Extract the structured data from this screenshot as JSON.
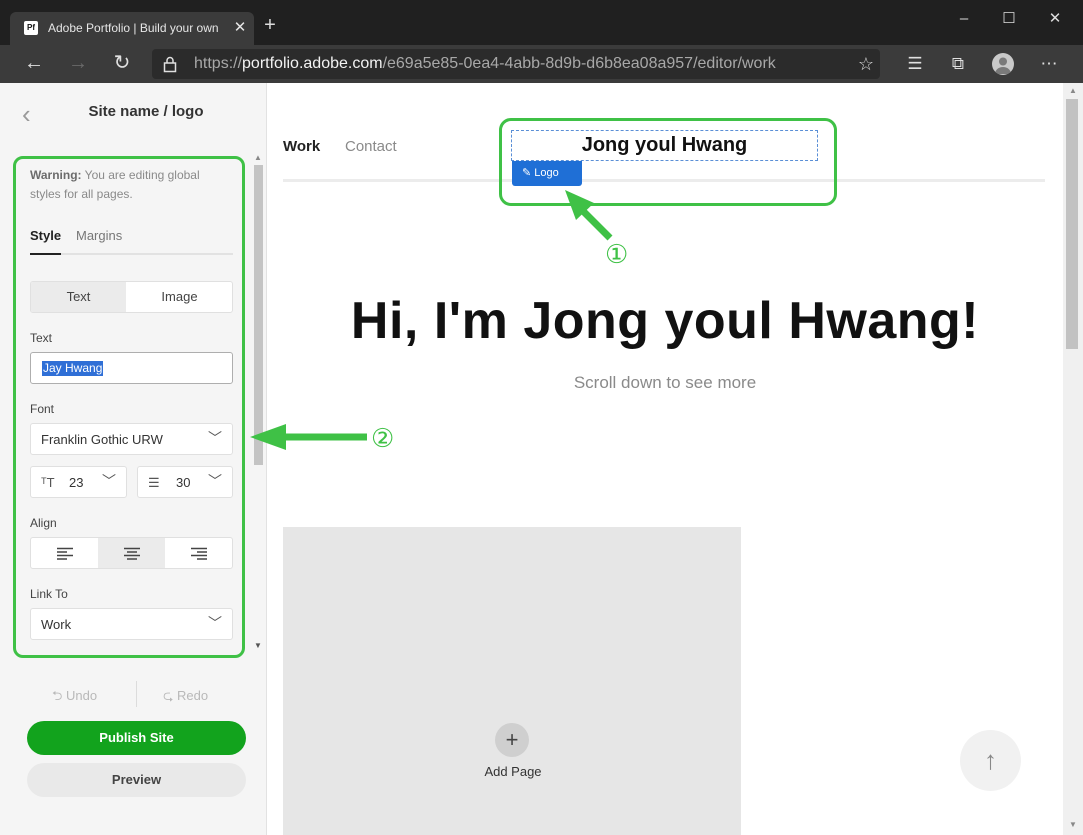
{
  "browser": {
    "tab_title": "Adobe Portfolio | Build your own",
    "tab_favicon": "Pf",
    "tab_close": "✕",
    "new_tab": "+",
    "url_prefix": "https://",
    "url_host": "portfolio.adobe.com",
    "url_path": "/e69a5e85-0ea4-4abb-8d9b-d6b8ea08a957/editor/work",
    "window_controls": {
      "minimize": "–",
      "maximize": "☐",
      "close": "✕"
    },
    "nav_icons": [
      "back-arrow-icon",
      "forward-arrow-icon",
      "refresh-icon"
    ],
    "toolbar_icons": [
      "favorites-star-icon",
      "reading-list-icon",
      "collections-icon",
      "profile-icon",
      "more-icon"
    ]
  },
  "panel": {
    "back": "‹",
    "title": "Site name / logo",
    "warning_bold": "Warning:",
    "warning_text": " You are editing global styles for all pages.",
    "tabs": {
      "style": "Style",
      "margins": "Margins"
    },
    "segment": {
      "text": "Text",
      "image": "Image"
    },
    "text_label": "Text",
    "text_value": "Jay Hwang",
    "font_label": "Font",
    "font_value": "Franklin Gothic URW",
    "size_icon": "ᵀT",
    "size_value": "23",
    "line_height_icon": "☰",
    "line_height_value": "30",
    "chevron": "﹀",
    "align_label": "Align",
    "align_selected": "center",
    "link_label": "Link To",
    "link_value": "Work",
    "undo": "⮌  Undo",
    "redo": "⮎  Redo",
    "publish": "Publish Site",
    "preview": "Preview"
  },
  "site": {
    "nav_work": "Work",
    "nav_contact": "Contact",
    "logo_text": "Jong youl Hwang",
    "logo_badge": "✎  Logo",
    "hero_title": "Hi, I'm Jong youl Hwang!",
    "hero_subtitle": "Scroll down to see more",
    "add_icon": "+",
    "add_page": "Add Page",
    "scroll_top": "↑"
  },
  "annotations": {
    "marker_1": "①",
    "marker_2": "②",
    "color": "#3fc146"
  },
  "colors": {
    "publish_green": "#12a31d",
    "logo_badge_blue": "#1f6fd6",
    "selection_blue": "#2f6fd6"
  }
}
